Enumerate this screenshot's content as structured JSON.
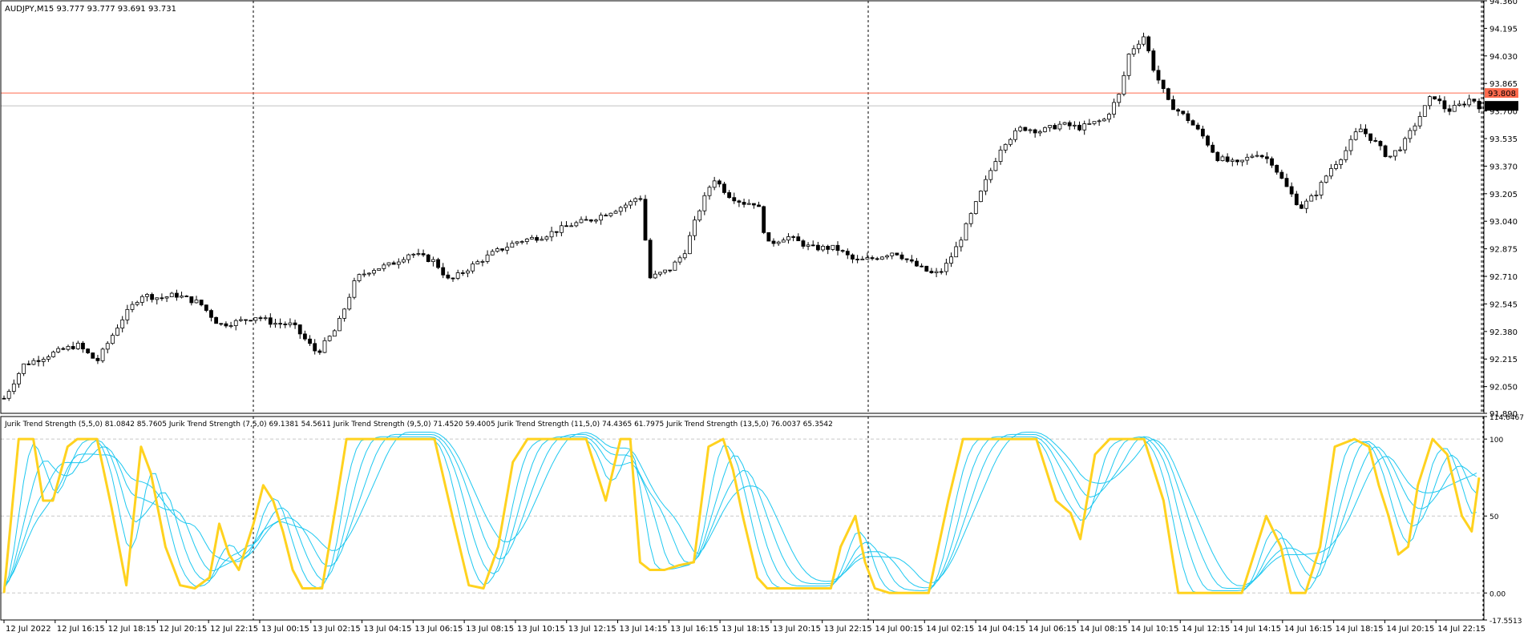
{
  "header": {
    "symbol_line": "AUDJPY,M15  93.777 93.777 93.691 93.731",
    "indicator_line": "Jurik Trend Strength (5,5,0) 81.0842 85.7605  Jurik Trend Strength (7,5,0) 69.1381 54.5611  Jurik Trend Strength (9,5,0) 71.4520 59.4005  Jurik Trend Strength (11,5,0) 74.4365 61.7975  Jurik Trend Strength (13,5,0) 76.0037 65.3542"
  },
  "price_axis": {
    "ticks": [
      "94.360",
      "94.195",
      "94.030",
      "93.865",
      "93.700",
      "93.535",
      "93.370",
      "93.205",
      "93.040",
      "92.875",
      "92.710",
      "92.545",
      "92.380",
      "92.215",
      "92.050",
      "91.890"
    ],
    "ask_label": "93.808",
    "bid_label": "93.731"
  },
  "indicator_axis": {
    "ticks": [
      "114.6467",
      "100",
      "50",
      "0.00",
      "-17.5513"
    ]
  },
  "time_axis": {
    "labels": [
      "12 Jul 2022",
      "12 Jul 16:15",
      "12 Jul 18:15",
      "12 Jul 20:15",
      "12 Jul 22:15",
      "13 Jul 00:15",
      "13 Jul 02:15",
      "13 Jul 04:15",
      "13 Jul 06:15",
      "13 Jul 08:15",
      "13 Jul 10:15",
      "13 Jul 12:15",
      "13 Jul 14:15",
      "13 Jul 16:15",
      "13 Jul 18:15",
      "13 Jul 20:15",
      "13 Jul 22:15",
      "14 Jul 00:15",
      "14 Jul 02:15",
      "14 Jul 04:15",
      "14 Jul 06:15",
      "14 Jul 08:15",
      "14 Jul 10:15",
      "14 Jul 12:15",
      "14 Jul 14:15",
      "14 Jul 16:15",
      "14 Jul 18:15",
      "14 Jul 20:15",
      "14 Jul 22:15"
    ]
  },
  "colors": {
    "background": "#ffffff",
    "frame": "#000000",
    "candle_up_body": "#ffffff",
    "candle_down_body": "#000000",
    "ask_line": "#ff6a4d",
    "bid_line": "#c0c0c0",
    "grid": "#c8c8c8",
    "jts5": "#ffd21f",
    "jts_other": "#1ec8f0"
  },
  "chart_data": [
    {
      "type": "candlestick",
      "symbol": "AUDJPY,M15",
      "ohlc_header": {
        "open": 93.777,
        "high": 93.777,
        "low": 93.691,
        "close": 93.731
      },
      "ylim": [
        91.89,
        94.36
      ],
      "ask": 93.808,
      "bid": 93.731,
      "anchors": [
        [
          0,
          91.98
        ],
        [
          8,
          92.18
        ],
        [
          20,
          92.25
        ],
        [
          30,
          92.3
        ],
        [
          38,
          92.2
        ],
        [
          48,
          92.45
        ],
        [
          56,
          92.6
        ],
        [
          64,
          92.58
        ],
        [
          70,
          92.6
        ],
        [
          80,
          92.55
        ],
        [
          88,
          92.42
        ],
        [
          96,
          92.44
        ],
        [
          103,
          92.47
        ],
        [
          110,
          92.43
        ],
        [
          118,
          92.42
        ],
        [
          122,
          92.35
        ],
        [
          128,
          92.25
        ],
        [
          136,
          92.4
        ],
        [
          144,
          92.7
        ],
        [
          150,
          92.75
        ],
        [
          158,
          92.78
        ],
        [
          166,
          92.85
        ],
        [
          176,
          92.8
        ],
        [
          182,
          92.68
        ],
        [
          192,
          92.78
        ],
        [
          200,
          92.85
        ],
        [
          210,
          92.92
        ],
        [
          220,
          92.95
        ],
        [
          232,
          93.02
        ],
        [
          240,
          93.05
        ],
        [
          248,
          93.1
        ],
        [
          256,
          93.15
        ],
        [
          260,
          93.2
        ],
        [
          264,
          92.7
        ],
        [
          272,
          92.75
        ],
        [
          278,
          92.85
        ],
        [
          284,
          93.1
        ],
        [
          290,
          93.3
        ],
        [
          296,
          93.2
        ],
        [
          302,
          93.15
        ],
        [
          308,
          93.15
        ],
        [
          312,
          92.9
        ],
        [
          320,
          92.95
        ],
        [
          330,
          92.88
        ],
        [
          340,
          92.88
        ],
        [
          348,
          92.8
        ],
        [
          356,
          92.82
        ],
        [
          364,
          92.86
        ],
        [
          372,
          92.78
        ],
        [
          380,
          92.72
        ],
        [
          384,
          92.75
        ],
        [
          390,
          92.9
        ],
        [
          396,
          93.1
        ],
        [
          402,
          93.3
        ],
        [
          408,
          93.5
        ],
        [
          416,
          93.6
        ],
        [
          424,
          93.58
        ],
        [
          432,
          93.62
        ],
        [
          440,
          93.6
        ],
        [
          450,
          93.65
        ],
        [
          456,
          93.8
        ],
        [
          460,
          94.05
        ],
        [
          466,
          94.15
        ],
        [
          470,
          93.95
        ],
        [
          476,
          93.75
        ],
        [
          484,
          93.65
        ],
        [
          490,
          93.55
        ],
        [
          496,
          93.42
        ],
        [
          504,
          93.38
        ],
        [
          512,
          93.45
        ],
        [
          518,
          93.4
        ],
        [
          524,
          93.25
        ],
        [
          530,
          93.12
        ],
        [
          536,
          93.2
        ],
        [
          542,
          93.35
        ],
        [
          548,
          93.45
        ],
        [
          554,
          93.6
        ],
        [
          560,
          93.52
        ],
        [
          566,
          93.42
        ],
        [
          572,
          93.5
        ],
        [
          578,
          93.65
        ],
        [
          584,
          93.8
        ],
        [
          590,
          93.7
        ],
        [
          596,
          93.74
        ],
        [
          600,
          93.78
        ],
        [
          603,
          93.73
        ]
      ],
      "candle_count": 300
    },
    {
      "type": "line",
      "name": "Jurik Trend Strength",
      "ylim": [
        -17.5513,
        114.6467
      ],
      "series": [
        {
          "name": "Jurik Trend Strength (5,5,0)",
          "last_values": [
            81.0842,
            85.7605
          ],
          "anchors": [
            [
              0,
              0
            ],
            [
              6,
              100
            ],
            [
              12,
              100
            ],
            [
              16,
              60
            ],
            [
              20,
              60
            ],
            [
              26,
              95
            ],
            [
              30,
              100
            ],
            [
              38,
              100
            ],
            [
              44,
              55
            ],
            [
              50,
              5
            ],
            [
              56,
              95
            ],
            [
              60,
              78
            ],
            [
              66,
              30
            ],
            [
              72,
              5
            ],
            [
              78,
              3
            ],
            [
              84,
              10
            ],
            [
              88,
              45
            ],
            [
              92,
              25
            ],
            [
              96,
              15
            ],
            [
              102,
              45
            ],
            [
              106,
              70
            ],
            [
              110,
              60
            ],
            [
              114,
              40
            ],
            [
              118,
              15
            ],
            [
              122,
              3
            ],
            [
              130,
              3
            ],
            [
              136,
              60
            ],
            [
              140,
              100
            ],
            [
              150,
              100
            ],
            [
              160,
              100
            ],
            [
              168,
              100
            ],
            [
              176,
              100
            ],
            [
              184,
              45
            ],
            [
              190,
              5
            ],
            [
              196,
              3
            ],
            [
              202,
              30
            ],
            [
              208,
              85
            ],
            [
              214,
              100
            ],
            [
              224,
              100
            ],
            [
              232,
              100
            ],
            [
              238,
              100
            ],
            [
              242,
              80
            ],
            [
              246,
              60
            ],
            [
              252,
              100
            ],
            [
              256,
              100
            ],
            [
              260,
              20
            ],
            [
              264,
              15
            ],
            [
              270,
              15
            ],
            [
              276,
              18
            ],
            [
              282,
              20
            ],
            [
              288,
              95
            ],
            [
              294,
              100
            ],
            [
              298,
              80
            ],
            [
              302,
              50
            ],
            [
              308,
              10
            ],
            [
              312,
              3
            ],
            [
              318,
              3
            ],
            [
              324,
              3
            ],
            [
              330,
              3
            ],
            [
              334,
              3
            ],
            [
              338,
              3
            ],
            [
              342,
              30
            ],
            [
              348,
              50
            ],
            [
              352,
              20
            ],
            [
              356,
              3
            ],
            [
              362,
              0
            ],
            [
              370,
              0
            ],
            [
              378,
              0
            ],
            [
              386,
              60
            ],
            [
              392,
              100
            ],
            [
              400,
              100
            ],
            [
              408,
              100
            ],
            [
              416,
              100
            ],
            [
              422,
              100
            ],
            [
              430,
              60
            ],
            [
              436,
              52
            ],
            [
              440,
              35
            ],
            [
              446,
              90
            ],
            [
              452,
              100
            ],
            [
              458,
              100
            ],
            [
              466,
              100
            ],
            [
              474,
              60
            ],
            [
              480,
              0
            ],
            [
              490,
              0
            ],
            [
              500,
              0
            ],
            [
              506,
              0
            ],
            [
              512,
              30
            ],
            [
              516,
              50
            ],
            [
              522,
              30
            ],
            [
              526,
              0
            ],
            [
              532,
              0
            ],
            [
              538,
              30
            ],
            [
              544,
              95
            ],
            [
              552,
              100
            ],
            [
              558,
              95
            ],
            [
              562,
              70
            ],
            [
              566,
              50
            ],
            [
              570,
              25
            ],
            [
              574,
              30
            ],
            [
              578,
              70
            ],
            [
              584,
              100
            ],
            [
              590,
              90
            ],
            [
              596,
              50
            ],
            [
              600,
              40
            ],
            [
              603,
              75
            ]
          ]
        },
        {
          "name": "Jurik Trend Strength (7,5,0)",
          "last_values": [
            69.1381,
            54.5611
          ]
        },
        {
          "name": "Jurik Trend Strength (9,5,0)",
          "last_values": [
            71.452,
            59.4005
          ]
        },
        {
          "name": "Jurik Trend Strength (11,5,0)",
          "last_values": [
            74.4365,
            61.7975
          ]
        },
        {
          "name": "Jurik Trend Strength (13,5,0)",
          "last_values": [
            76.0037,
            65.3542
          ]
        }
      ],
      "levels": [
        100,
        50,
        0
      ]
    }
  ]
}
